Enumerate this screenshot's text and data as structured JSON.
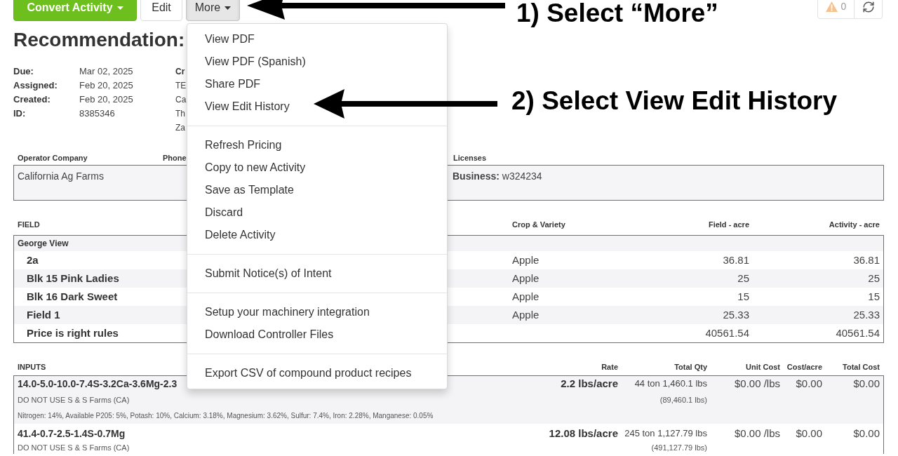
{
  "toolbar": {
    "buttons": [
      {
        "label": "Convert Activity",
        "kind": "primary_menu",
        "expanded": false
      },
      {
        "label": "Edit",
        "kind": "plain",
        "expanded": false
      },
      {
        "label": "More",
        "kind": "menu",
        "expanded": true
      }
    ],
    "warning_count": "0"
  },
  "title": "Recommendation:",
  "details": [
    {
      "label": "Due:",
      "value": "Mar 02, 2025"
    },
    {
      "label": "Assigned:",
      "value": "Feb 20, 2025"
    },
    {
      "label": "Created:",
      "value": "Feb 20, 2025"
    },
    {
      "label": "ID:",
      "value": "8385346"
    }
  ],
  "details_column_3": [
    {
      "text": "Cr",
      "kind": "label"
    },
    {
      "text": "TE",
      "kind": "value"
    },
    {
      "text": "Ca",
      "kind": "value"
    },
    {
      "text": "Th",
      "kind": "value"
    },
    {
      "text": "Za",
      "kind": "value"
    }
  ],
  "contacts": {
    "columns": [
      {
        "header": "Operator Company",
        "value": "California Ag Farms"
      },
      {
        "header": "Phone"
      },
      {
        "header": "Licenses",
        "value": "**Business:** w324234"
      }
    ]
  },
  "fields_table": {
    "columns": [
      "FIELD",
      "Crop & Variety",
      "Field - acre",
      "Activity - acre"
    ],
    "groups": [
      {
        "name": "George View",
        "children": [
          {
            "name": "2a",
            "crop": "Apple",
            "field_acre": "36.81",
            "activity_acre": "36.81"
          },
          {
            "name": "Blk 15 Pink Ladies",
            "crop": "Apple",
            "field_acre": "25",
            "activity_acre": "25"
          },
          {
            "name": "Blk 16 Dark Sweet",
            "crop": "Apple",
            "field_acre": "15",
            "activity_acre": "15"
          },
          {
            "name": "Field 1",
            "crop": "Apple",
            "field_acre": "25.33",
            "activity_acre": "25.33"
          },
          {
            "name": "Price is right rules",
            "field_acre": "40561.54",
            "activity_acre": "40561.54"
          }
        ]
      }
    ]
  },
  "inputs_table": {
    "columns": [
      "INPUTS",
      "Rate",
      "Total Qty",
      "Unit Cost",
      "Cost/acre",
      "Total Cost"
    ],
    "rows": [
      {
        "product": "14.0-5.0-10.0-7.4S-3.2Ca-3.6Mg-2.3",
        "supplier": "DO NOT USE S & S Farms (CA)",
        "analysis": "Nitrogen: 14%, Available P205: 5%, Potash: 10%, Calcium: 3.18%, Magnesium: 3.62%, Sulfur: 7.4%, Iron: 2.28%, Manganese: 0.05%",
        "rate": "2.2 lbs/acre",
        "total_qty": "44 ton 1,460.1 lbs",
        "total_lbs": "(89,460.1 lbs)",
        "unit_cost": "$0.00 /lbs",
        "cost_per_acre": "$0.00",
        "total_cost": "$0.00"
      },
      {
        "product": "41.4-0.7-2.5-1.4S-0.7Mg",
        "supplier": "DO NOT USE S & S Farms (CA)",
        "rate": "12.08 lbs/acre",
        "total_qty": "245 ton 1,127.79 lbs",
        "total_lbs": "(491,127.79 lbs)",
        "unit_cost": "$0.00 /lbs",
        "cost_per_acre": "$0.00",
        "total_cost": "$0.00"
      }
    ]
  },
  "more_menu": {
    "sections": [
      {
        "items": [
          "View PDF",
          "View PDF (Spanish)",
          "Share PDF",
          "View Edit History"
        ]
      },
      {
        "items": [
          "Refresh Pricing",
          "Copy to new Activity",
          "Save as Template",
          "Discard",
          "Delete Activity"
        ]
      },
      {
        "items": [
          "Submit Notice(s) of Intent"
        ]
      },
      {
        "items": [
          "Setup your machinery integration",
          "Download Controller Files"
        ]
      },
      {
        "items": [
          "Export CSV of compound product recipes"
        ]
      }
    ]
  },
  "annotations": [
    {
      "text": "1) Select “More”"
    },
    {
      "text": "2) Select View Edit History"
    }
  ]
}
